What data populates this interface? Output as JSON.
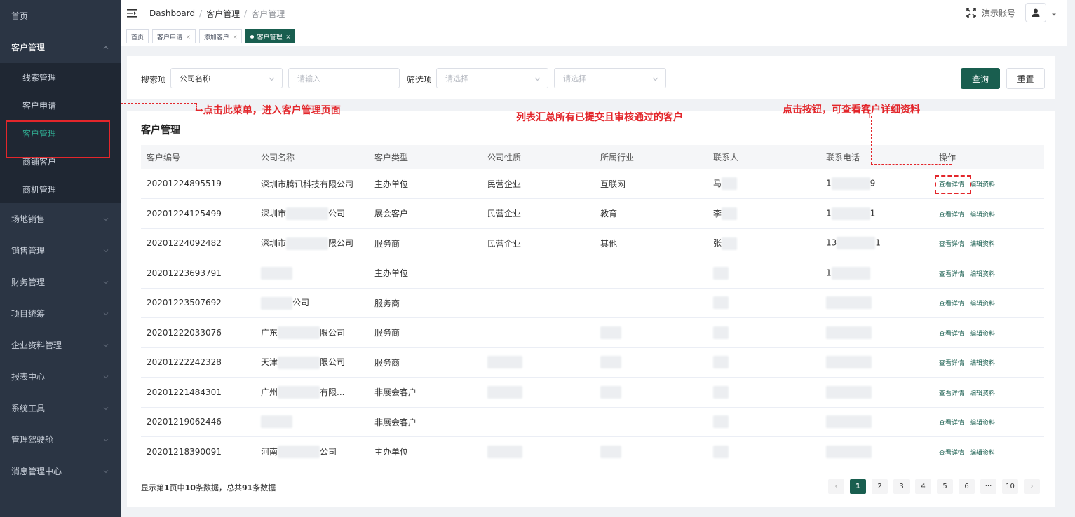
{
  "sidebar": {
    "items": [
      {
        "label": "首页",
        "chevron": false
      },
      {
        "label": "客户管理",
        "chevron": true,
        "open": true,
        "children": [
          {
            "label": "线索管理"
          },
          {
            "label": "客户申请"
          },
          {
            "label": "客户管理",
            "active": true
          },
          {
            "label": "商铺客户"
          },
          {
            "label": "商机管理"
          }
        ]
      },
      {
        "label": "场地销售",
        "chevron": true
      },
      {
        "label": "销售管理",
        "chevron": true
      },
      {
        "label": "财务管理",
        "chevron": true
      },
      {
        "label": "项目统筹",
        "chevron": true
      },
      {
        "label": "企业资料管理",
        "chevron": true
      },
      {
        "label": "报表中心",
        "chevron": true
      },
      {
        "label": "系统工具",
        "chevron": true
      },
      {
        "label": "管理驾驶舱",
        "chevron": true
      },
      {
        "label": "消息管理中心",
        "chevron": true
      }
    ]
  },
  "header": {
    "breadcrumb": [
      "Dashboard",
      "客户管理",
      "客户管理"
    ],
    "account_name": "演示账号"
  },
  "tags": [
    {
      "label": "首页",
      "closable": false,
      "active": false
    },
    {
      "label": "客户申请",
      "closable": true,
      "active": false
    },
    {
      "label": "添加客户",
      "closable": true,
      "active": false
    },
    {
      "label": "客户管理",
      "closable": true,
      "active": true
    }
  ],
  "search": {
    "search_label": "搜索项",
    "search_field_value": "公司名称",
    "keyword_placeholder": "请输入",
    "filter_label": "筛选项",
    "filter1_placeholder": "请选择",
    "filter2_placeholder": "请选择",
    "query_button": "查询",
    "reset_button": "重置"
  },
  "table": {
    "title": "客户管理",
    "columns": [
      "客户编号",
      "公司名称",
      "客户类型",
      "公司性质",
      "所属行业",
      "联系人",
      "联系电话",
      "操作"
    ],
    "rows": [
      {
        "id": "20201224895519",
        "company": "深圳市腾讯科技有限公司",
        "type": "主办单位",
        "nature": "民营企业",
        "industry": "互联网",
        "contact": "马",
        "phone": "1",
        "phone_tail": "9"
      },
      {
        "id": "20201224125499",
        "company": "深圳市",
        "company_tail": "公司",
        "type": "展会客户",
        "nature": "民营企业",
        "industry": "教育",
        "contact": "李",
        "phone": "1",
        "phone_tail": "1"
      },
      {
        "id": "20201224092482",
        "company": "深圳市",
        "company_tail": "限公司",
        "type": "服务商",
        "nature": "民营企业",
        "industry": "其他",
        "contact": "张",
        "phone": "13",
        "phone_tail": "1"
      },
      {
        "id": "20201223693791",
        "company": "",
        "type": "主办单位",
        "nature": "",
        "industry": "",
        "contact": "",
        "phone": "1"
      },
      {
        "id": "20201223507692",
        "company": "",
        "company_tail": "公司",
        "type": "服务商",
        "nature": "",
        "industry": "",
        "contact": "",
        "phone": ""
      },
      {
        "id": "20201222033076",
        "company": "广东",
        "company_tail": "限公司",
        "type": "服务商",
        "nature": "",
        "industry": "",
        "contact": "",
        "phone": ""
      },
      {
        "id": "20201222242328",
        "company": "天津",
        "company_tail": "限公司",
        "type": "服务商",
        "nature": "",
        "industry": "",
        "contact": "",
        "phone": ""
      },
      {
        "id": "20201221484301",
        "company": "广州",
        "company_tail": "有限...",
        "type": "非展会客户",
        "nature": "",
        "industry": "",
        "contact": "",
        "phone": ""
      },
      {
        "id": "20201219062446",
        "company": "",
        "type": "非展会客户",
        "nature": "",
        "industry": "",
        "contact": "",
        "phone": ""
      },
      {
        "id": "20201218390091",
        "company": "河南",
        "company_tail": "公司",
        "type": "主办单位",
        "nature": "",
        "industry": "",
        "contact": "",
        "phone": ""
      }
    ],
    "actions": {
      "view": "查看详情",
      "edit": "编辑资料"
    }
  },
  "pagination": {
    "info_prefix": "显示第",
    "current_page": "1",
    "info_mid": "页中",
    "page_size": "10",
    "info_mid2": "条数据，总共",
    "total": "91",
    "info_suffix": "条数据",
    "pages": [
      "1",
      "2",
      "3",
      "4",
      "5",
      "6",
      "···",
      "10"
    ]
  },
  "annotations": {
    "menu_hint": "点击此菜单，进入客户管理页面",
    "list_hint": "列表汇总所有已提交且审核通过的客户",
    "button_hint": "点击按钮，可查看客户详细资料"
  },
  "colors": {
    "sidebar_bg": "#2b3544",
    "primary": "#195e4f",
    "annotation": "#e3262b"
  }
}
